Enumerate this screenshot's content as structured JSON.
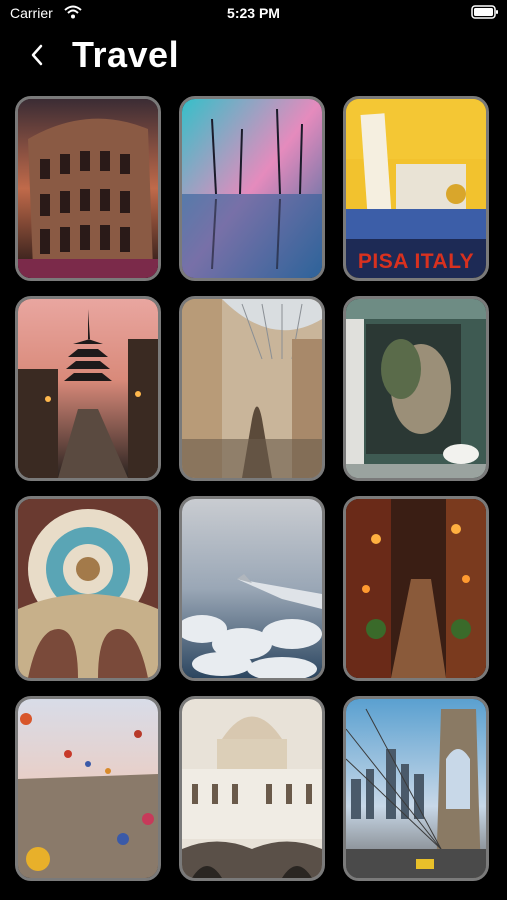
{
  "status": {
    "carrier": "Carrier",
    "time": "5:23 PM"
  },
  "nav": {
    "title": "Travel"
  },
  "tiles": [
    {
      "id": "colosseum",
      "caption": ""
    },
    {
      "id": "palm-reflection",
      "caption": ""
    },
    {
      "id": "pisa-poster",
      "caption": "PISA ITALY"
    },
    {
      "id": "pagoda-street",
      "caption": ""
    },
    {
      "id": "galleria",
      "caption": ""
    },
    {
      "id": "tropical-bathroom",
      "caption": ""
    },
    {
      "id": "baroque-dome",
      "caption": ""
    },
    {
      "id": "airplane-clouds",
      "caption": ""
    },
    {
      "id": "lantern-alley",
      "caption": ""
    },
    {
      "id": "hot-air-balloons",
      "caption": ""
    },
    {
      "id": "st-peters",
      "caption": ""
    },
    {
      "id": "brooklyn-bridge",
      "caption": ""
    }
  ]
}
